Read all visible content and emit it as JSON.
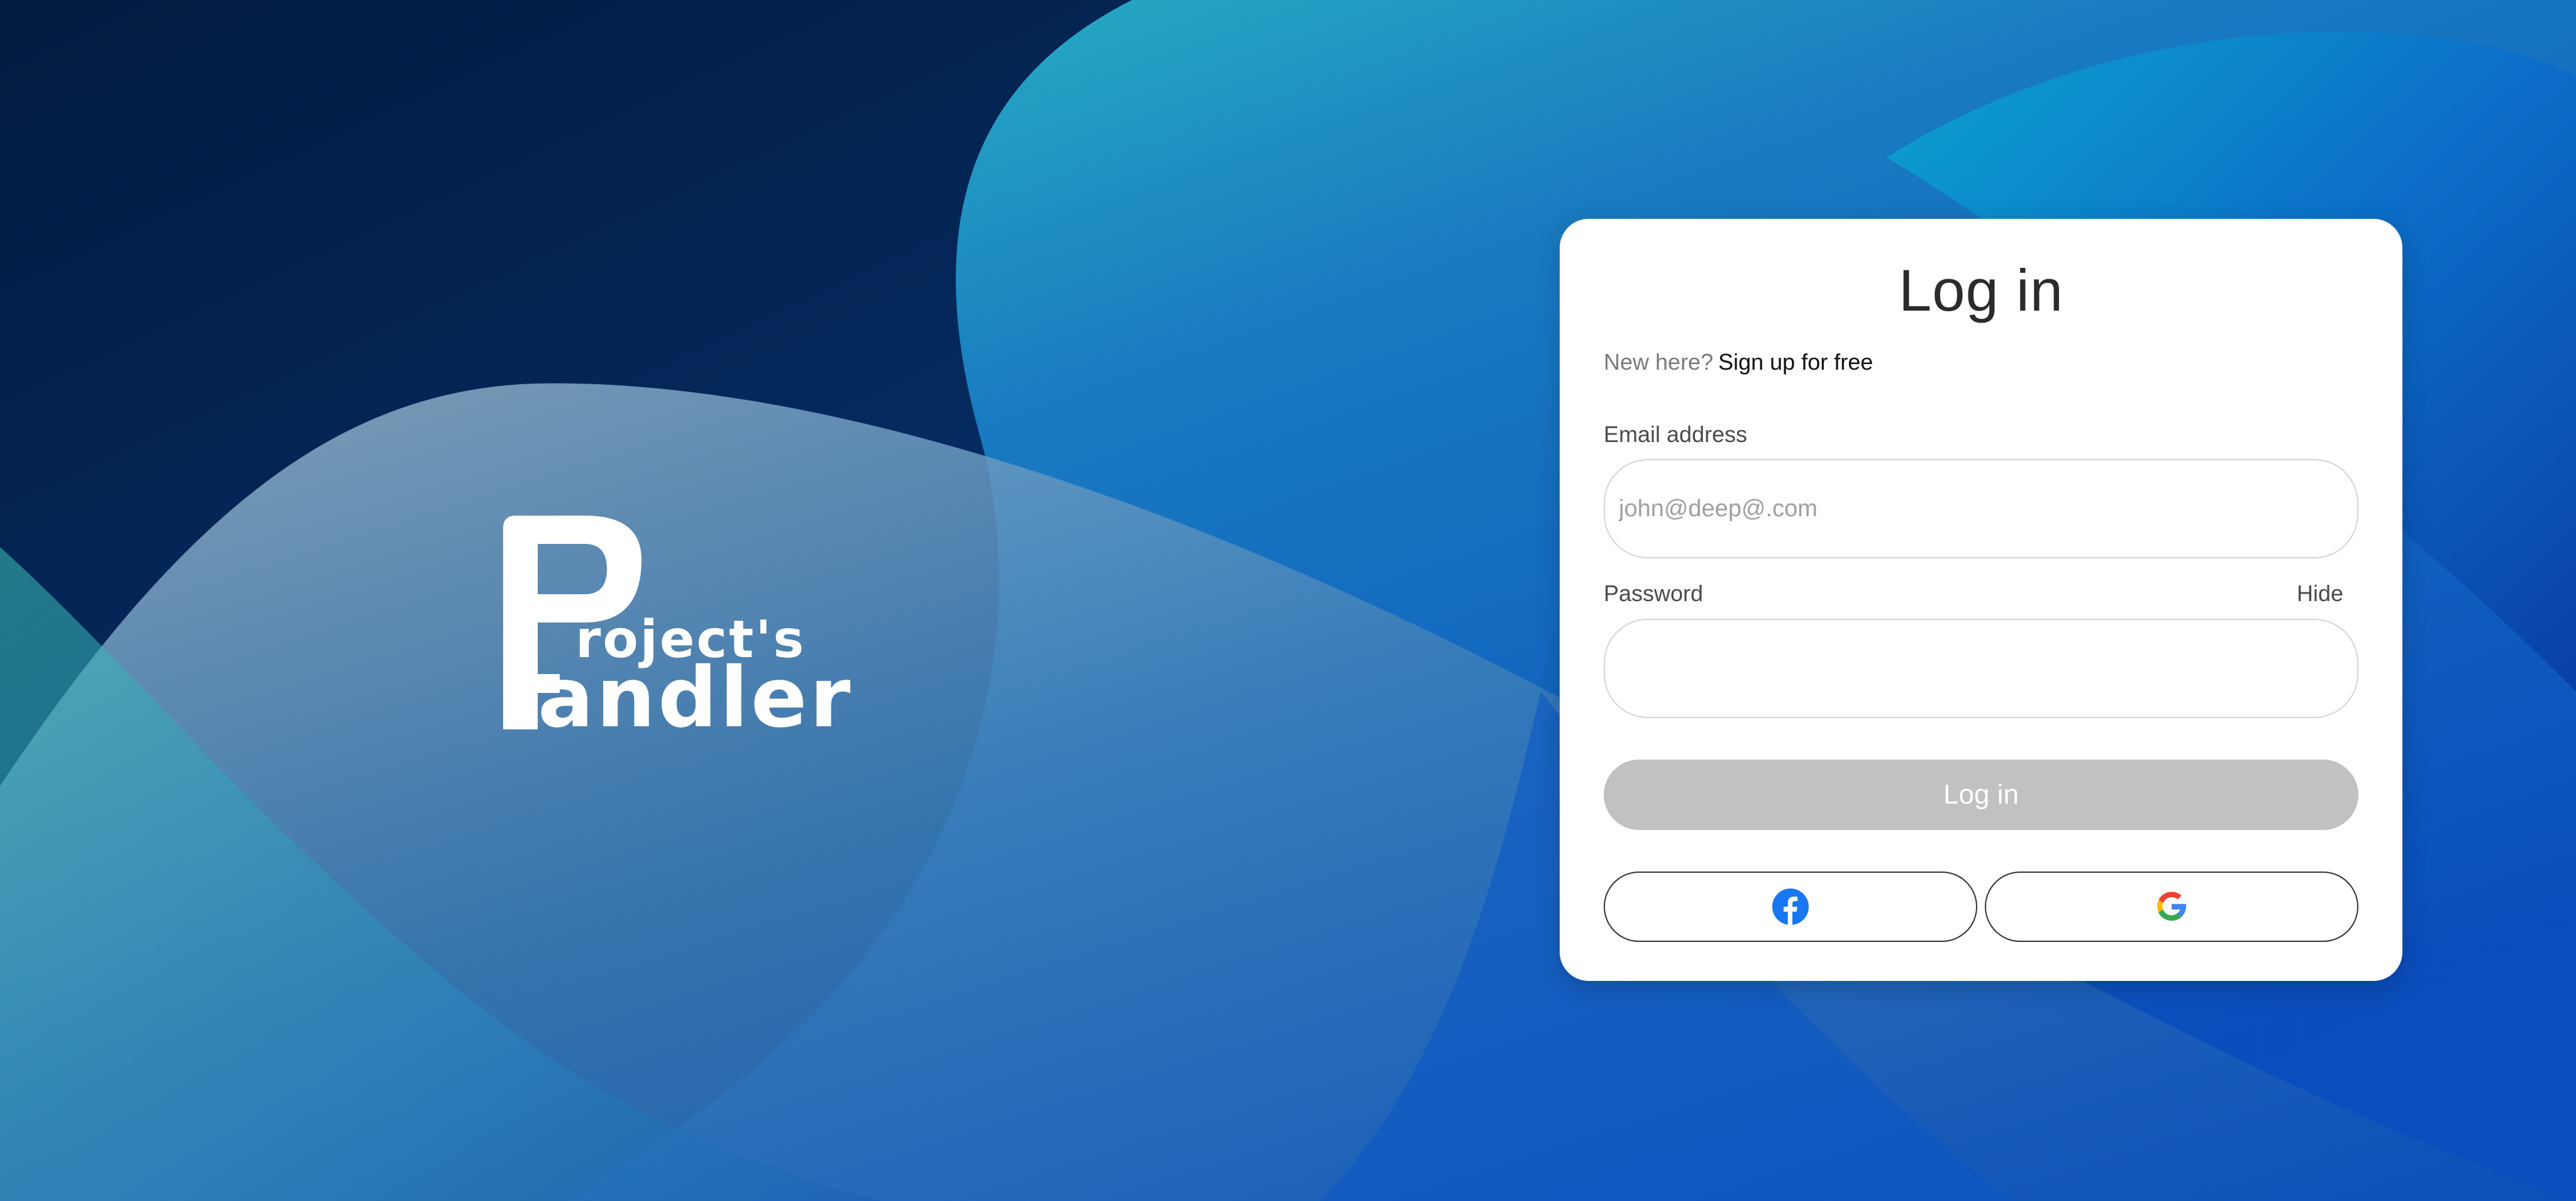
{
  "brand": {
    "logo_line1": "roject's",
    "logo_line2": "andler",
    "logo_initial1": "P",
    "logo_initial2": "H"
  },
  "login_card": {
    "title": "Log in",
    "new_here": "New here?",
    "signup_link": "Sign up for free",
    "email_label": "Email address",
    "email_placeholder": "john@deep@.com",
    "email_value": "",
    "password_label": "Password",
    "password_toggle": "Hide",
    "password_value": "",
    "submit_label": "Log in",
    "social": [
      {
        "provider": "facebook",
        "icon": "facebook-icon",
        "color": "#1877F2"
      },
      {
        "provider": "google",
        "icon": "google-icon",
        "colors": [
          "#4285F4",
          "#EA4335",
          "#FBBC05",
          "#34A853"
        ]
      }
    ]
  },
  "colors": {
    "background_dark": "#041a3d",
    "background_blue": "#0a56c4",
    "background_teal": "#2bb3c0",
    "button_disabled": "#c1c1c1",
    "card": "#ffffff"
  }
}
